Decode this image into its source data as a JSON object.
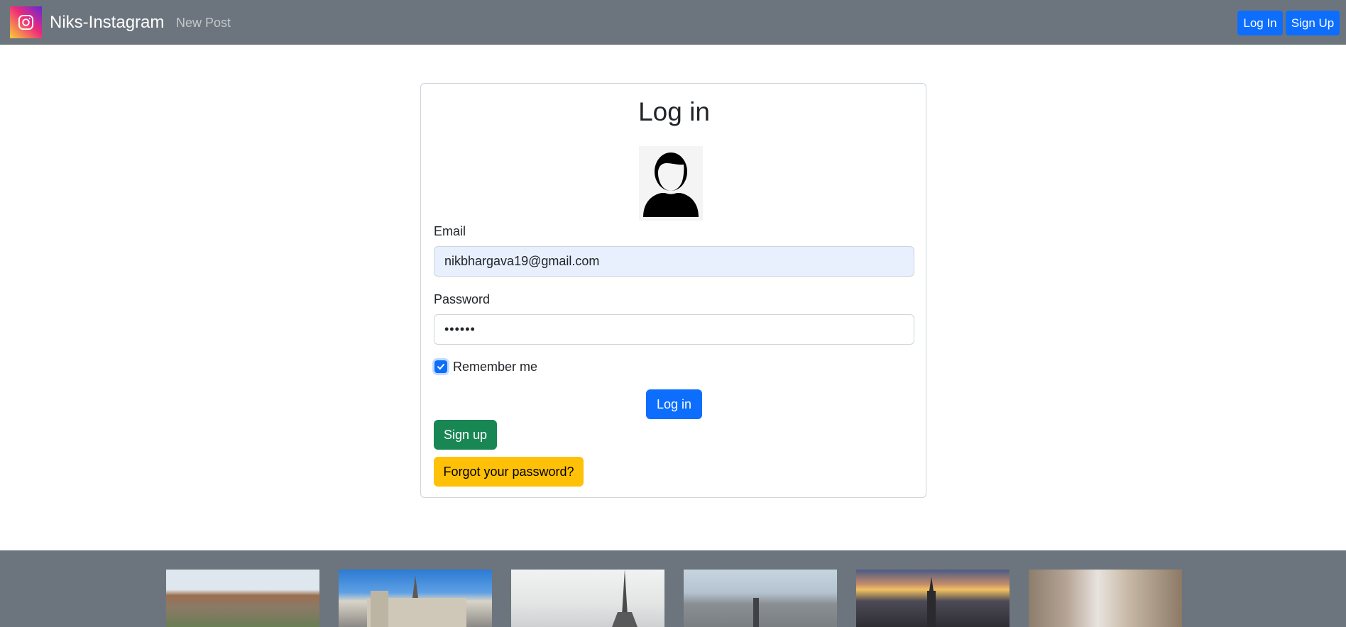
{
  "navbar": {
    "brand_name": "Niks-Instagram",
    "new_post_label": "New Post",
    "login_label": "Log In",
    "signup_label": "Sign Up"
  },
  "login_card": {
    "title": "Log in",
    "email_label": "Email",
    "email_value": "nikbhargava19@gmail.com",
    "password_label": "Password",
    "password_value": "••••••",
    "remember_label": "Remember me",
    "remember_checked": true,
    "login_button": "Log in",
    "signup_button": "Sign up",
    "forgot_button": "Forgot your password?"
  },
  "gallery": {
    "images": [
      "louvre-image",
      "notre-dame-image",
      "eiffel-tower-image",
      "paris-skyline-image",
      "city-sunset-image",
      "paris-street-image"
    ]
  },
  "colors": {
    "navbar_bg": "#6c757d",
    "primary": "#0d6efd",
    "success": "#198754",
    "warning": "#ffc107"
  }
}
